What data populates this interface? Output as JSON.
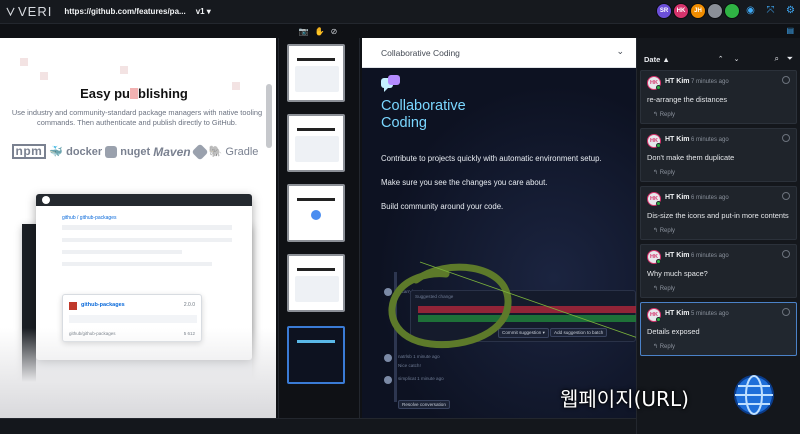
{
  "app": {
    "logo_text": "VERI",
    "url": "https://github.com/features/pa...",
    "version": "v1 ▾"
  },
  "collaborators": [
    {
      "initials": "SR",
      "color": "#6b4fd8"
    },
    {
      "initials": "HK",
      "color": "#d6336c"
    },
    {
      "initials": "JH",
      "color": "#f08c00"
    },
    {
      "initials": "",
      "color": "#8a8f98"
    },
    {
      "initials": "",
      "color": "#2fb344"
    }
  ],
  "left_page": {
    "heading": "Easy publishing",
    "heading_pre": "Easy pu",
    "heading_post": "blishing",
    "lead": "Use industry and community-standard package managers with native tooling commands. Then authenticate and publish directly to GitHub.",
    "brands": [
      "npm",
      "docker",
      "nuget",
      "Maven",
      "",
      "Gradle"
    ],
    "mock": {
      "crumb": "github / github-packages",
      "package_name": "github-packages",
      "package_version": "2.0.0",
      "package_meta": "github/github-packages",
      "package_stats": "5  612"
    }
  },
  "center_page": {
    "header_title": "Collaborative Coding",
    "hero_title_line1": "Collaborative",
    "hero_title_line2": "Coding",
    "paragraphs": [
      "Contribute to projects quickly with automatic environment setup.",
      "Make sure you see the changes you care about.",
      "Build community around your code."
    ],
    "screenshot": {
      "comment_author": "jhcarryl  2 minutes ago",
      "suggested": "Suggested change",
      "add_suggestion": "Add suggestion to batch",
      "commit_suggestion": "Commit suggestion ▾",
      "reply_author": "natrlsb  1 minute ago",
      "reply_text": "Nice catch!",
      "reply2_author": "simplicat  1 minute ago",
      "resolve": "Resolve conversation"
    }
  },
  "comments": {
    "sort_label": "Date ▲",
    "arrows": "⌃ ⌄",
    "items": [
      {
        "initials": "HK",
        "name": "HT Kim",
        "time": "7 minutes ago",
        "text": "re-arrange the distances",
        "reply": "Reply",
        "selected": false
      },
      {
        "initials": "HK",
        "name": "HT Kim",
        "time": "6 minutes ago",
        "text": "Don't make them duplicate",
        "reply": "Reply",
        "selected": false
      },
      {
        "initials": "HK",
        "name": "HT Kim",
        "time": "6 minutes ago",
        "text": "Dis-size the icons and put-in more contents",
        "reply": "Reply",
        "selected": false
      },
      {
        "initials": "HK",
        "name": "HT Kim",
        "time": "6 minutes ago",
        "text": "Why much space?",
        "reply": "Reply",
        "selected": false
      },
      {
        "initials": "HK",
        "name": "HT Kim",
        "time": "5 minutes ago",
        "text": "Details exposed",
        "reply": "Reply",
        "selected": true
      }
    ]
  },
  "watermark": "웹페이지(URL)",
  "colors": {
    "accent": "#3fa9f5",
    "selected_border": "#4b82c8",
    "hero_text": "#7ad7ff",
    "annotation_green": "#5d7a2a"
  }
}
